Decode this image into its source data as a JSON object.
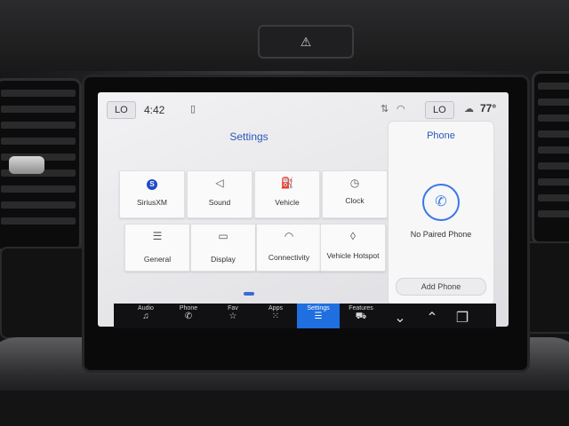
{
  "status_bar": {
    "left_climate": "LO",
    "time": "4:42",
    "right_climate": "LO",
    "outside_temp": "77°"
  },
  "settings": {
    "title": "Settings",
    "tiles": [
      {
        "label": "SiriusXM",
        "icon": "siriusxm-icon"
      },
      {
        "label": "Sound",
        "icon": "speaker-icon"
      },
      {
        "label": "Vehicle",
        "icon": "vehicle-icon"
      },
      {
        "label": "Clock",
        "icon": "clock-icon"
      },
      {
        "label": "General",
        "icon": "sliders-icon"
      },
      {
        "label": "Display",
        "icon": "display-icon"
      },
      {
        "label": "Connectivity",
        "icon": "wifi-icon"
      },
      {
        "label": "Vehicle Hotspot",
        "icon": "hotspot-icon"
      }
    ]
  },
  "phone_panel": {
    "title": "Phone",
    "status": "No Paired Phone",
    "add_button": "Add Phone"
  },
  "dock": {
    "items": [
      {
        "label": "Audio",
        "icon": "music-note-icon"
      },
      {
        "label": "Phone",
        "icon": "phone-icon"
      },
      {
        "label": "Fav",
        "icon": "star-icon"
      },
      {
        "label": "Apps",
        "icon": "apps-grid-icon"
      },
      {
        "label": "Settings",
        "icon": "settings-sliders-icon",
        "active": true
      },
      {
        "label": "Features",
        "icon": "car-features-icon"
      }
    ]
  },
  "colors": {
    "accent": "#2a57b7",
    "active_tab": "#1f6fe0"
  }
}
